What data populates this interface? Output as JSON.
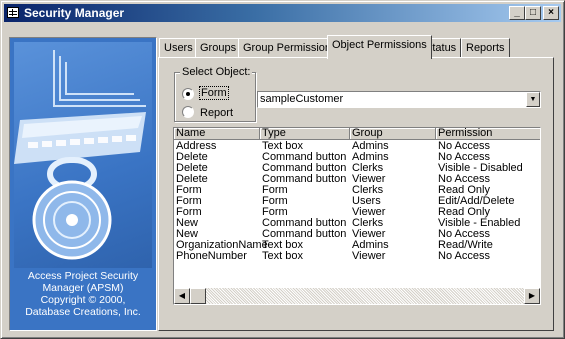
{
  "window": {
    "title": "Security Manager",
    "minimize_icon": "minimize-icon",
    "maximize_icon": "maximize-icon",
    "close_icon": "close-icon"
  },
  "sidebar": {
    "image": "laptop-padlock-illustration",
    "credit_lines": [
      "Access Project Security",
      "Manager (APSM)",
      "Copyright © 2000,",
      "Database Creations, Inc."
    ]
  },
  "tabs": [
    {
      "label": "Users"
    },
    {
      "label": "Groups"
    },
    {
      "label": "Group Permissions"
    },
    {
      "label": "Object Permissions",
      "active": true
    },
    {
      "label": "Status"
    },
    {
      "label": "Reports"
    }
  ],
  "select_object": {
    "legend": "Select Object:",
    "options": [
      "Form",
      "Report"
    ],
    "selected": "Form"
  },
  "object_combo": {
    "value": "sampleCustomer"
  },
  "permissions_table": {
    "columns": [
      "Name",
      "Type",
      "Group",
      "Permission"
    ],
    "rows": [
      [
        "Address",
        "Text box",
        "Admins",
        "No Access"
      ],
      [
        "Delete",
        "Command button",
        "Admins",
        "No Access"
      ],
      [
        "Delete",
        "Command button",
        "Clerks",
        "Visible - Disabled"
      ],
      [
        "Delete",
        "Command button",
        "Viewer",
        "No Access"
      ],
      [
        "Form",
        "Form",
        "Clerks",
        "Read Only"
      ],
      [
        "Form",
        "Form",
        "Users",
        "Edit/Add/Delete"
      ],
      [
        "Form",
        "Form",
        "Viewer",
        "Read Only"
      ],
      [
        "New",
        "Command button",
        "Clerks",
        "Visible - Enabled"
      ],
      [
        "New",
        "Command button",
        "Viewer",
        "No Access"
      ],
      [
        "OrganizationName",
        "Text box",
        "Admins",
        "Read/Write"
      ],
      [
        "PhoneNumber",
        "Text box",
        "Viewer",
        "No Access"
      ]
    ]
  },
  "colors": {
    "title_bar": "#0a246a",
    "sidebar_bg": "#3a74c4",
    "desktop_bg": "#f4b8a8"
  }
}
